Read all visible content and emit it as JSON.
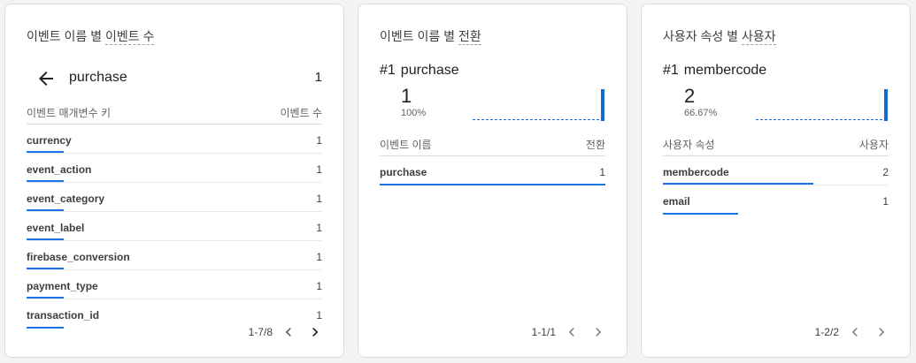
{
  "card1": {
    "title_prefix": "이벤트 이름 별 ",
    "title_metric": "이벤트 수",
    "back_label": "purchase",
    "back_value": "1",
    "col_left": "이벤트 매개변수 키",
    "col_right": "이벤트 수",
    "rows": [
      {
        "label": "currency",
        "value": "1"
      },
      {
        "label": "event_action",
        "value": "1"
      },
      {
        "label": "event_category",
        "value": "1"
      },
      {
        "label": "event_label",
        "value": "1"
      },
      {
        "label": "firebase_conversion",
        "value": "1"
      },
      {
        "label": "payment_type",
        "value": "1"
      },
      {
        "label": "transaction_id",
        "value": "1"
      }
    ],
    "pager_text": "1-7/8"
  },
  "card2": {
    "title_prefix": "이벤트 이름 별 ",
    "title_metric": "전환",
    "rank": "#1",
    "top_name": "purchase",
    "big_value": "1",
    "percent": "100%",
    "col_left": "이벤트 이름",
    "col_right": "전환",
    "rows": [
      {
        "label": "purchase",
        "value": "1",
        "share": 1.0
      }
    ],
    "pager_text": "1-1/1"
  },
  "card3": {
    "title_prefix": "사용자 속성 별 ",
    "title_metric": "사용자",
    "rank": "#1",
    "top_name": "membercode",
    "big_value": "2",
    "percent": "66.67%",
    "col_left": "사용자 속성",
    "col_right": "사용자",
    "rows": [
      {
        "label": "membercode",
        "value": "2",
        "share": 0.667
      },
      {
        "label": "email",
        "value": "1",
        "share": 0.333
      }
    ],
    "pager_text": "1-2/2"
  },
  "colors": {
    "accent": "#1a73e8",
    "bar": "#1967d2",
    "disabled": "#80868b"
  }
}
